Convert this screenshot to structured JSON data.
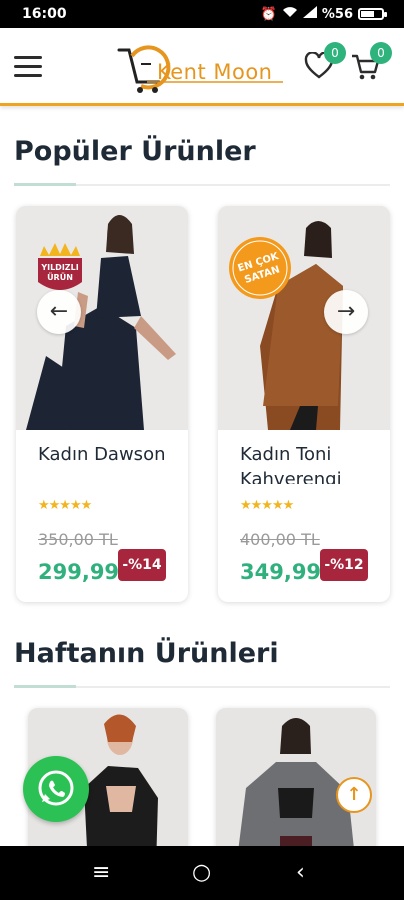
{
  "status_bar": {
    "time": "16:00",
    "battery": "%56"
  },
  "header": {
    "logo_text": "Kent Moon",
    "wishlist_count": "0",
    "cart_count": "0"
  },
  "sections": [
    {
      "title": "Popüler Ürünler",
      "products": [
        {
          "name": "Kadın Dawson",
          "badge": "YILDIZLI ÜRÜN",
          "old_price": "350,00 TL",
          "price": "299,99",
          "discount": "-%14",
          "rating": 5
        },
        {
          "name": "Kadın Toni Kahverengi",
          "badge": "EN ÇOK SATAN",
          "old_price": "400,00 TL",
          "price": "349,99",
          "discount": "-%12",
          "rating": 5
        }
      ]
    },
    {
      "title": "Haftanın Ürünleri"
    }
  ],
  "icons": {
    "menu": "hamburger-icon",
    "wishlist": "heart-icon",
    "cart": "cart-icon",
    "prev": "arrow-left-icon",
    "next": "arrow-right-icon",
    "whatsapp": "whatsapp-icon",
    "scroll_top": "arrow-up-icon"
  },
  "colors": {
    "brand": "#e6961f",
    "badge_green": "#2fb37c",
    "price_green": "#30b07d",
    "discount_red": "#a8263d"
  },
  "nav": {
    "menu": "≡",
    "home": "○",
    "back": "‹"
  }
}
